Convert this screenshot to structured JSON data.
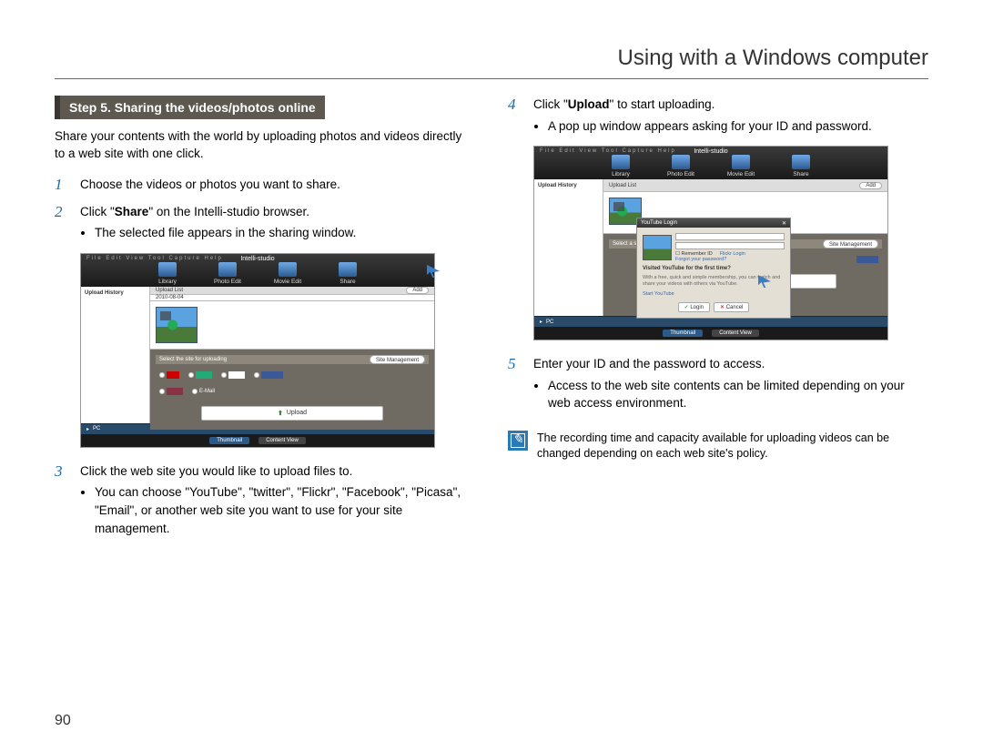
{
  "header": "Using with a Windows computer",
  "page_number": "90",
  "step_bar": "Step 5. Sharing the videos/photos online",
  "intro": "Share your contents with the world by uploading photos and videos directly to a web site with one click.",
  "steps": {
    "s1": {
      "num": "1",
      "text": "Choose the videos or photos you want to share."
    },
    "s2": {
      "num": "2",
      "text_pre": "Click \"",
      "bold": "Share",
      "text_post": "\" on the Intelli-studio browser.",
      "sub1": "The selected file appears in the sharing window."
    },
    "s3": {
      "num": "3",
      "text": "Click the web site you would like to upload files to.",
      "sub1": "You can choose \"YouTube\", \"twitter\", \"Flickr\", \"Facebook\", \"Picasa\", \"Email\", or another web site you want to use for your site management."
    },
    "s4": {
      "num": "4",
      "text_pre": "Click \"",
      "bold": "Upload",
      "text_post": "\" to start uploading.",
      "sub1": "A pop up window appears asking for your ID and password."
    },
    "s5": {
      "num": "5",
      "text": "Enter your ID and the password to access.",
      "sub1": "Access to the web site contents can be limited depending on your web access environment."
    }
  },
  "note": "The recording time and capacity available for uploading videos can be changed depending on each web site's policy.",
  "shot1": {
    "title": "Intelli-studio",
    "tabs": {
      "library": "Library",
      "photo": "Photo Edit",
      "movie": "Movie Edit",
      "share": "Share"
    },
    "sidebar": "Upload History",
    "upload_list": "Upload List",
    "date": "2010-08-04",
    "add": "Add",
    "site_hdr": "Select the site for uploading",
    "site_mgr": "Site Management",
    "sites": {
      "yt": "YouTube",
      "tw": "twitter",
      "fl": "flickr",
      "fb": "facebook",
      "pic": "Picasa",
      "em": "E-Mail"
    },
    "upload_btn": "Upload",
    "footer": "PC",
    "thumb_btn": "Thumbnail",
    "cont_btn": "Content View"
  },
  "shot2": {
    "popup_title": "YouTube Login",
    "remember": "Remember ID",
    "flickr_login": "Flickr Login",
    "forgot": "Forgot your password?",
    "visited": "Visited YouTube for the first time?",
    "desc": "With a free, quick and simple membership, you can watch and share your videos with others via YouTube.",
    "start": "Start YouTube",
    "login": "Login",
    "cancel": "Cancel",
    "select_site": "Select a site",
    "site_mgmt": "Site Management",
    "fb": "facebook"
  }
}
